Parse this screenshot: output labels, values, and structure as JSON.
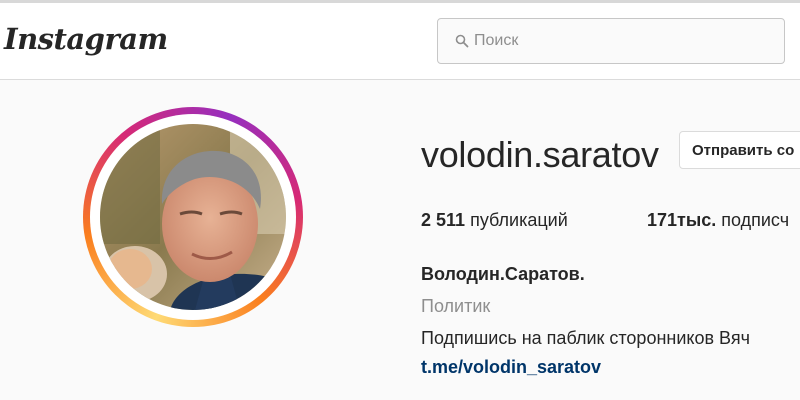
{
  "header": {
    "logo_text": "Instagram",
    "search": {
      "placeholder": "Поиск",
      "value": "",
      "icon": "search-icon"
    }
  },
  "profile": {
    "username": "volodin.saratov",
    "send_message_label": "Отправить со",
    "stats": {
      "posts_count": "2 511",
      "posts_label": "публикаций",
      "followers_count": "171тыс.",
      "followers_label": "подписч"
    },
    "full_name": "Володин.Саратов.",
    "category": "Политик",
    "bio": "Подпишись на паблик сторонников Вяч",
    "link": "t.me/volodin_saratov",
    "avatar": "profile-photo"
  },
  "colors": {
    "story_ring": [
      "#feda75",
      "#fa7e1e",
      "#d62976",
      "#962fbf"
    ],
    "link": "#003569",
    "muted_text": "#8e8e8e",
    "border": "#dbdbdb"
  }
}
